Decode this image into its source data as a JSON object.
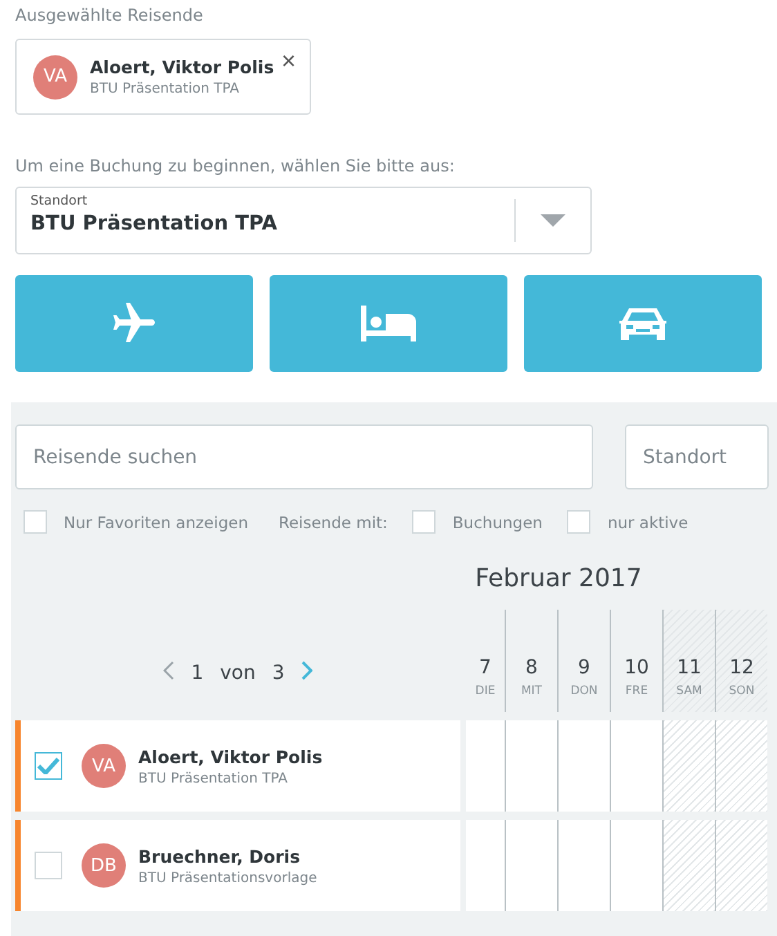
{
  "selected_travelers": {
    "heading": "Ausgewählte Reisende",
    "chips": [
      {
        "initials": "VA",
        "name": "Aloert, Viktor Polis",
        "org": "BTU Präsentation TPA",
        "close": "×"
      }
    ]
  },
  "booking": {
    "prompt": "Um eine Buchung zu beginnen, wählen Sie bitte aus:",
    "location": {
      "label": "Standort",
      "value": "BTU Präsentation TPA"
    },
    "buttons": [
      {
        "kind": "flight"
      },
      {
        "kind": "hotel"
      },
      {
        "kind": "car"
      }
    ]
  },
  "filters": {
    "search": {
      "placeholder": "Reisende suchen"
    },
    "location": {
      "placeholder": "Standort"
    },
    "options": [
      {
        "label": "Nur Favoriten anzeigen",
        "checked": false
      },
      {
        "kind": "label",
        "label": "Reisende mit:"
      },
      {
        "label": "Buchungen",
        "checked": false
      },
      {
        "label": "nur aktive",
        "checked": false
      }
    ]
  },
  "calendar": {
    "month": "Februar 2017",
    "pager": {
      "current": "1",
      "of": "von",
      "total": "3"
    },
    "days": [
      {
        "day": "7",
        "weekday": "DIE",
        "weekend": false
      },
      {
        "day": "8",
        "weekday": "MIT",
        "weekend": false
      },
      {
        "day": "9",
        "weekday": "DON",
        "weekend": false
      },
      {
        "day": "10",
        "weekday": "FRE",
        "weekend": false
      },
      {
        "day": "11",
        "weekday": "SAM",
        "weekend": true
      },
      {
        "day": "12",
        "weekday": "SON",
        "weekend": true
      }
    ]
  },
  "travelers": [
    {
      "initials": "VA",
      "name": "Aloert, Viktor Polis",
      "org": "BTU Präsentation TPA",
      "checked": true
    },
    {
      "initials": "DB",
      "name": "Bruechner, Doris",
      "org": "BTU Präsentationsvorlage",
      "checked": false
    }
  ]
}
